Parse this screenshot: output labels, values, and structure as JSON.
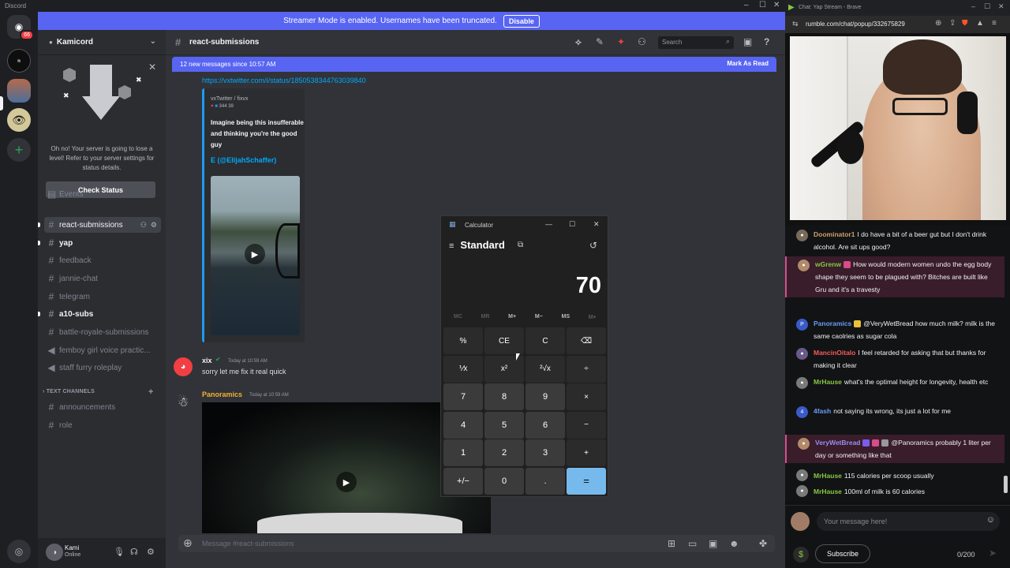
{
  "discord": {
    "app_title": "Discord",
    "streamer_banner": {
      "text": "Streamer Mode is enabled. Usernames have been truncated.",
      "button": "Disable"
    },
    "guild_badge": "66",
    "server_name": "Kamicord",
    "boost_notice": {
      "text": "Oh no! Your server is going to lose a level! Refer to your server settings for status details.",
      "button": "Check Status"
    },
    "events_label": "Events",
    "channels": [
      {
        "name": "react-submissions",
        "state": "active"
      },
      {
        "name": "yap",
        "state": "unread"
      },
      {
        "name": "feedback",
        "state": "normal"
      },
      {
        "name": "jannie-chat",
        "state": "normal"
      },
      {
        "name": "telegram",
        "state": "normal"
      },
      {
        "name": "a10-subs",
        "state": "unread"
      },
      {
        "name": "battle-royale-submissions",
        "state": "normal"
      },
      {
        "name": "femboy girl voice practic...",
        "state": "voice"
      },
      {
        "name": "staff furry roleplay",
        "state": "voice"
      }
    ],
    "category": "TEXT CHANNELS",
    "category_channels": [
      "announcements",
      "role"
    ],
    "user": {
      "name": "Kami",
      "status": "Online"
    },
    "chat": {
      "channel": "react-submissions",
      "search_placeholder": "Search",
      "new_messages": "12 new messages since 10:57 AM",
      "mark_read": "Mark As Read",
      "link": "https://vxtwitter.com/i/status/1850538344763039840",
      "embed": {
        "author": "vxTwitter / fixvx",
        "stats": "344  39",
        "description": "Imagine being this insufferable and thinking you're the good guy",
        "handle": "E (@ElijahSchaffer)"
      },
      "messages": [
        {
          "author": "xix",
          "time": "Today at 10:59 AM",
          "text": "sorry let me fix it real quick",
          "color": "#f2f3f5"
        },
        {
          "author": "Panoramics",
          "time": "Today at 10:59 AM",
          "text": "",
          "color": "#f0b232"
        }
      ],
      "composer_placeholder": "Message #react-submissions"
    }
  },
  "calculator": {
    "title": "Calculator",
    "mode": "Standard",
    "display": "70",
    "memory": [
      "MC",
      "MR",
      "M+",
      "M−",
      "MS",
      "M▾"
    ],
    "keys": [
      "%",
      "CE",
      "C",
      "⌫",
      "⅟x",
      "x²",
      "²√x",
      "÷",
      "7",
      "8",
      "9",
      "×",
      "4",
      "5",
      "6",
      "−",
      "1",
      "2",
      "3",
      "+",
      "+/−",
      "0",
      ".",
      "="
    ]
  },
  "browser": {
    "window_title": "Chat: Yap Stream - Brave",
    "url": "rumble.com/chat/popup/332675829",
    "chat": [
      {
        "user": "Doominator1",
        "color": "#c9a26a",
        "text": "I do have a bit of a beer gut but I don't drink alcohol. Are sit ups good?",
        "highlight": false
      },
      {
        "user": "wGrenw",
        "color": "#85c742",
        "text": "How would modern women undo the egg body shape they seem to be plagued with? Bitches are built like Gru and it's a travesty",
        "highlight": true
      },
      {
        "user": "Panoramics",
        "color": "#6a9cf7",
        "text": "@VeryWetBread how much milk? milk is the same caolries as sugar cola",
        "highlight": false
      },
      {
        "user": "MancinOitalo",
        "color": "#f25c5c",
        "text": "I feel retarded for asking that but thanks for making it clear",
        "highlight": false
      },
      {
        "user": "MrHause",
        "color": "#85c742",
        "text": "what's the optimal height for longevity, health etc",
        "highlight": false
      },
      {
        "user": "4fash",
        "color": "#6a9cf7",
        "text": "not saying its wrong, its just a lot for me",
        "highlight": false
      },
      {
        "user": "VeryWetBread",
        "color": "#9b8cf2",
        "text": "@Panoramics probably 1 liter per day or something like that",
        "highlight": true
      },
      {
        "user": "MrHause",
        "color": "#85c742",
        "text": "115 calories per scoop usually",
        "highlight": false
      },
      {
        "user": "MrHause",
        "color": "#85c742",
        "text": "100ml of milk is 60 calories",
        "highlight": false
      }
    ],
    "message_placeholder": "Your message here!",
    "subscribe": "Subscribe",
    "char_count": "0/200"
  }
}
